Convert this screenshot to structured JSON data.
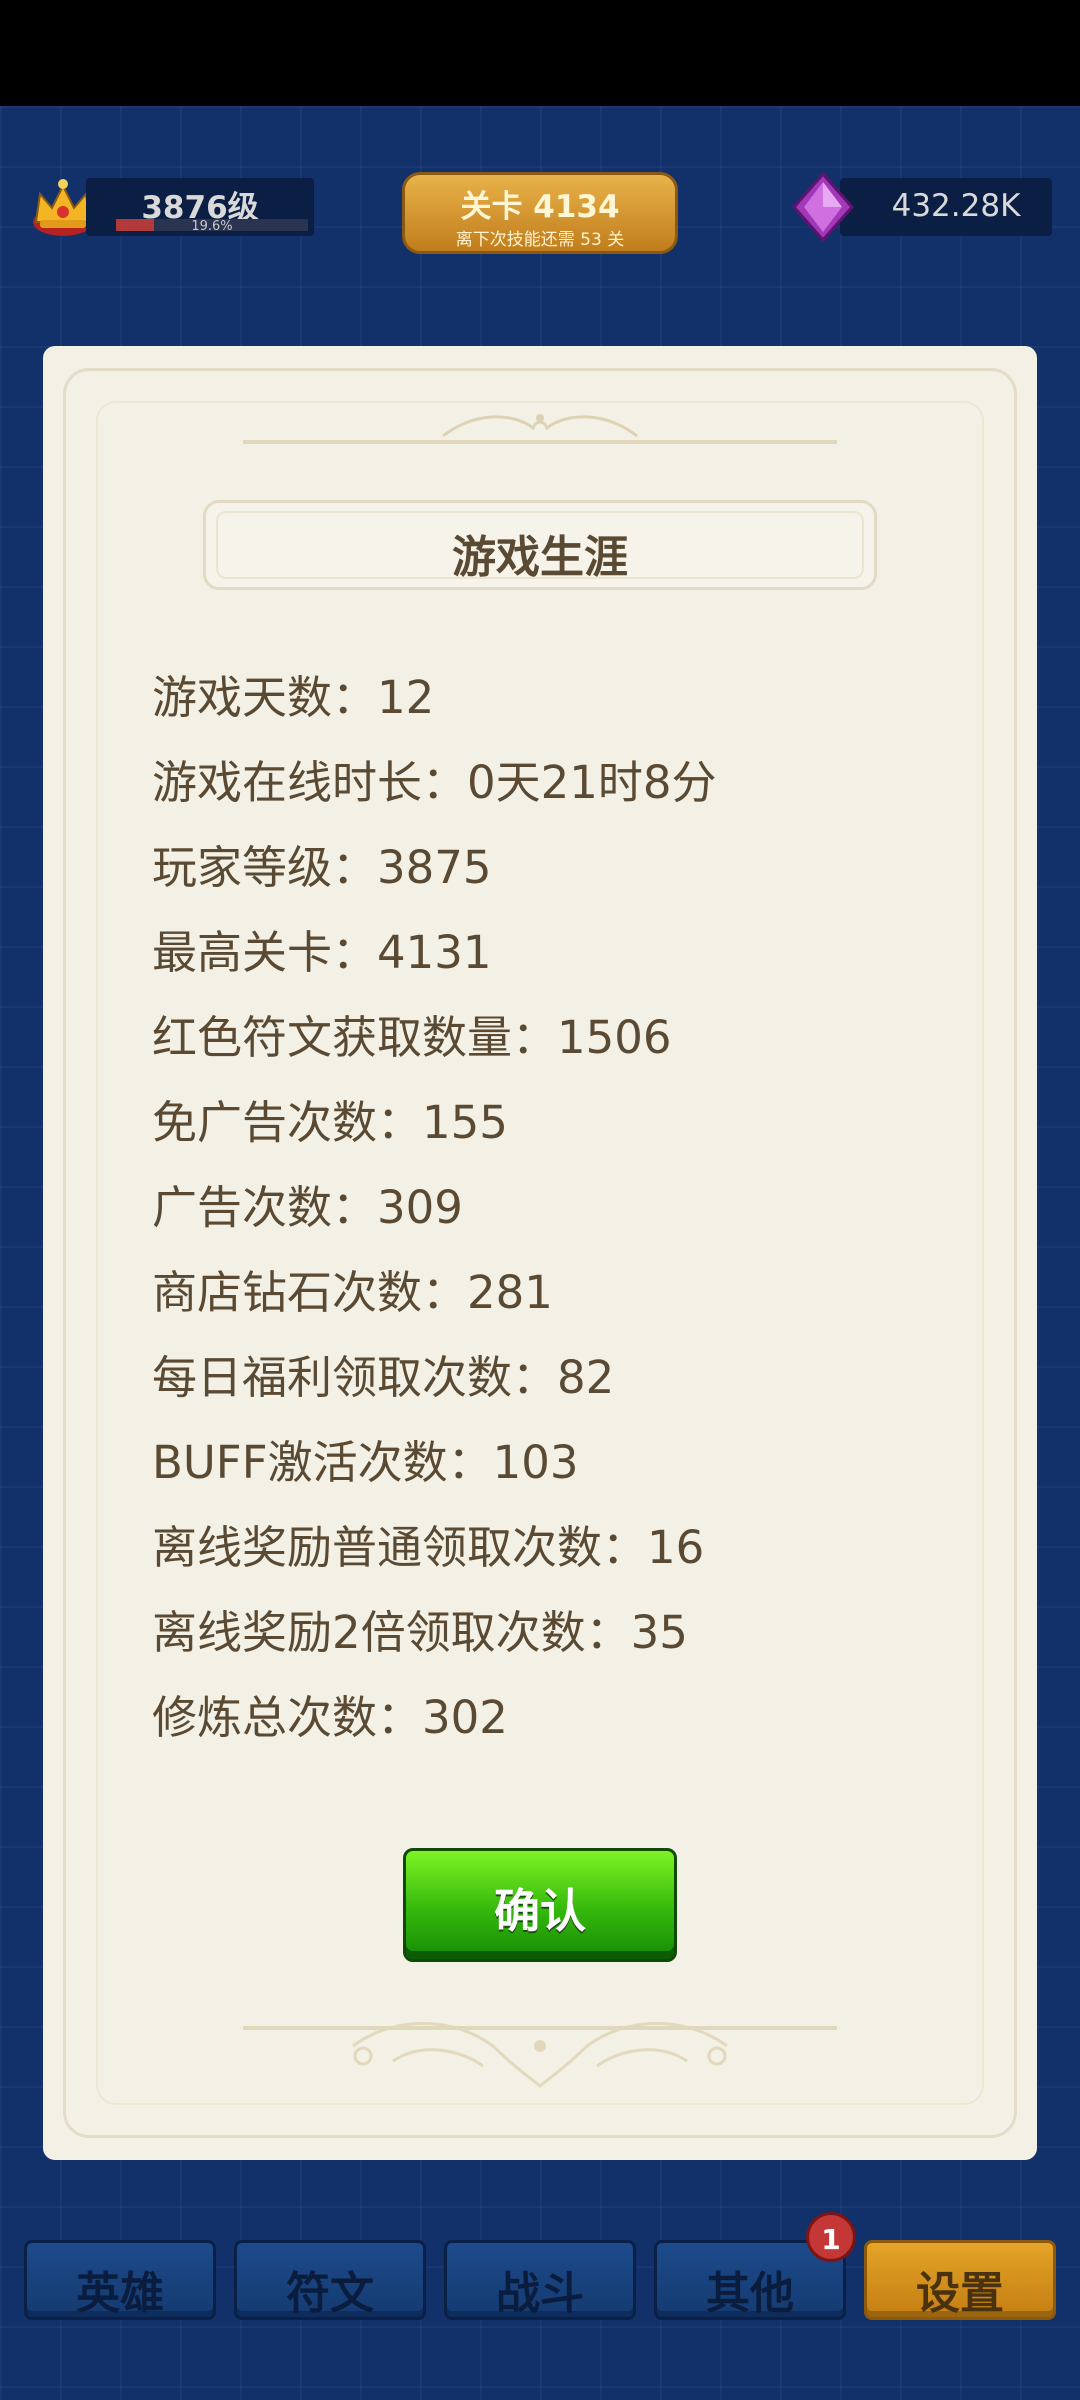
{
  "hud": {
    "level_label": "3876级",
    "level_percent": "19.6%",
    "level_progress": 0.196,
    "stage_title": "关卡 4134",
    "stage_subtitle": "离下次技能还需 53 关",
    "gems": "432.28K"
  },
  "modal": {
    "title": "游戏生涯",
    "stats": [
      "游戏天数：12",
      "游戏在线时长：0天21时8分",
      "玩家等级：3875",
      "最高关卡：4131",
      "红色符文获取数量：1506",
      "免广告次数：155",
      "广告次数：309",
      "商店钻石次数：281",
      "每日福利领取次数：82",
      "BUFF激活次数：103",
      "离线奖励普通领取次数：16",
      "离线奖励2倍领取次数：35",
      "修炼总次数：302"
    ],
    "confirm_label": "确认"
  },
  "tabs": [
    {
      "label": "英雄"
    },
    {
      "label": "符文"
    },
    {
      "label": "战斗"
    },
    {
      "label": "其他"
    },
    {
      "label": "设置"
    }
  ],
  "badge_count": "1",
  "colors": {
    "background": "#12306a",
    "modal_bg": "#f3f1e6",
    "text_brown": "#5b4a33",
    "confirm_green": "#35b80c",
    "active_tab": "#e3a428"
  }
}
